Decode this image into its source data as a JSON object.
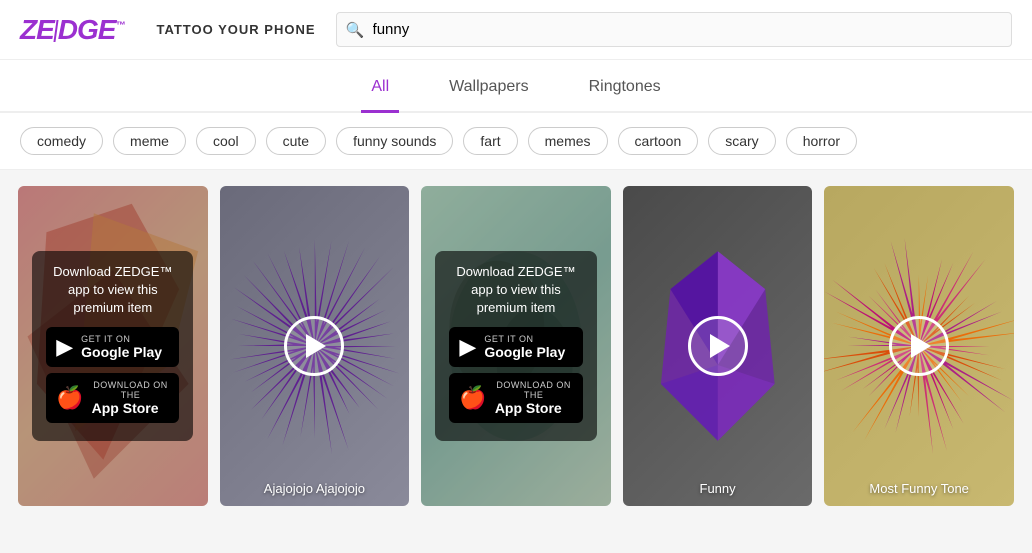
{
  "header": {
    "logo": "ZEDGE",
    "logo_tm": "™",
    "tagline": "TATTOO YOUR PHONE",
    "search_placeholder": "funny",
    "search_value": "funny"
  },
  "nav": {
    "tabs": [
      {
        "id": "all",
        "label": "All",
        "active": true
      },
      {
        "id": "wallpapers",
        "label": "Wallpapers",
        "active": false
      },
      {
        "id": "ringtones",
        "label": "Ringtones",
        "active": false
      }
    ]
  },
  "tags": {
    "items": [
      "comedy",
      "meme",
      "cool",
      "cute",
      "funny sounds",
      "fart",
      "memes",
      "cartoon",
      "scary",
      "horror"
    ]
  },
  "grid": {
    "cards": [
      {
        "id": 1,
        "title": "",
        "premium": true,
        "style": "card-1",
        "premium_text": "Download ZEDGE™ app to view this premium item"
      },
      {
        "id": 2,
        "title": "Ajajojojo Ajajojojo",
        "premium": false,
        "style": "card-2"
      },
      {
        "id": 3,
        "title": "",
        "premium": true,
        "style": "card-3",
        "premium_text": "Download ZEDGE™ app to view this premium item"
      },
      {
        "id": 4,
        "title": "Funny",
        "premium": false,
        "style": "card-4"
      },
      {
        "id": 5,
        "title": "Most Funny Tone",
        "premium": false,
        "style": "card-5"
      }
    ],
    "store_google_line1": "GET IT ON",
    "store_google_line2": "Google Play",
    "store_apple_line1": "Download on the",
    "store_apple_line2": "App Store"
  }
}
